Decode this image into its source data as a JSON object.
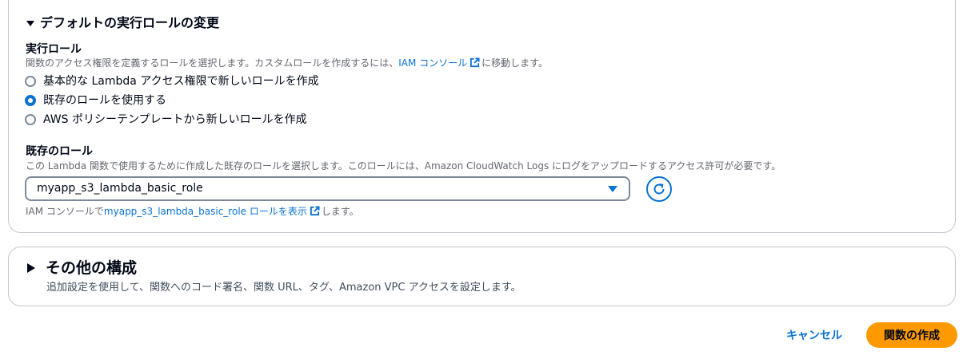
{
  "default_role_section": {
    "title": "デフォルトの実行ロールの変更",
    "execution_role": {
      "label": "実行ロール",
      "description_before": "関数のアクセス権限を定義するロールを選択します。カスタムロールを作成するには、",
      "description_link": "IAM コンソール",
      "description_after": "に移動します。",
      "options": [
        {
          "label": "基本的な Lambda アクセス権限で新しいロールを作成",
          "selected": false
        },
        {
          "label": "既存のロールを使用する",
          "selected": true
        },
        {
          "label": "AWS ポリシーテンプレートから新しいロールを作成",
          "selected": false
        }
      ]
    },
    "existing_role": {
      "label": "既存のロール",
      "description": "この Lambda 関数で使用するために作成した既存のロールを選択します。このロールには、Amazon CloudWatch Logs にログをアップロードするアクセス許可が必要です。",
      "selected_value": "myapp_s3_lambda_basic_role",
      "hint_before": "IAM コンソールで",
      "hint_link": "myapp_s3_lambda_basic_role ロールを表示",
      "hint_after": "します。"
    }
  },
  "other_config_section": {
    "title": "その他の構成",
    "description": "追加設定を使用して、関数へのコード署名、関数 URL、タグ、Amazon VPC アクセスを設定します。"
  },
  "footer": {
    "cancel_label": "キャンセル",
    "create_label": "関数の作成"
  },
  "colors": {
    "accent": "#0972d3",
    "primary_button": "#ff9900",
    "border": "#c6c6cd"
  },
  "icons": [
    "caret-down-icon",
    "external-link-icon",
    "refresh-icon",
    "caret-right-icon"
  ]
}
